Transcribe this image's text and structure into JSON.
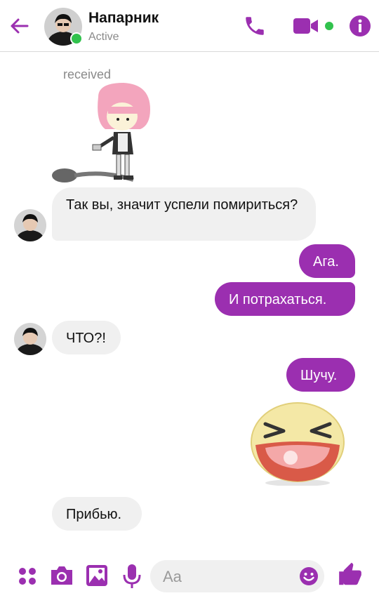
{
  "header": {
    "name": "Напарник",
    "status": "Active",
    "icons": [
      "back-arrow-icon",
      "phone-icon",
      "video-camera-icon",
      "info-icon"
    ],
    "accent": "#9b2fb0",
    "online_color": "#31c24d"
  },
  "messages": [
    {
      "label": "received"
    },
    {
      "text": "Так вы, значит успели помириться?"
    },
    {
      "text": "Ага."
    },
    {
      "text": "И потрахаться."
    },
    {
      "text": "ЧТО?!"
    },
    {
      "text": "Шучу."
    },
    {
      "text": "Прибью."
    }
  ],
  "composer": {
    "placeholder": "Aa",
    "icons": [
      "apps-icon",
      "camera-icon",
      "gallery-icon",
      "microphone-icon",
      "emoji-icon",
      "thumbs-up-icon"
    ]
  }
}
